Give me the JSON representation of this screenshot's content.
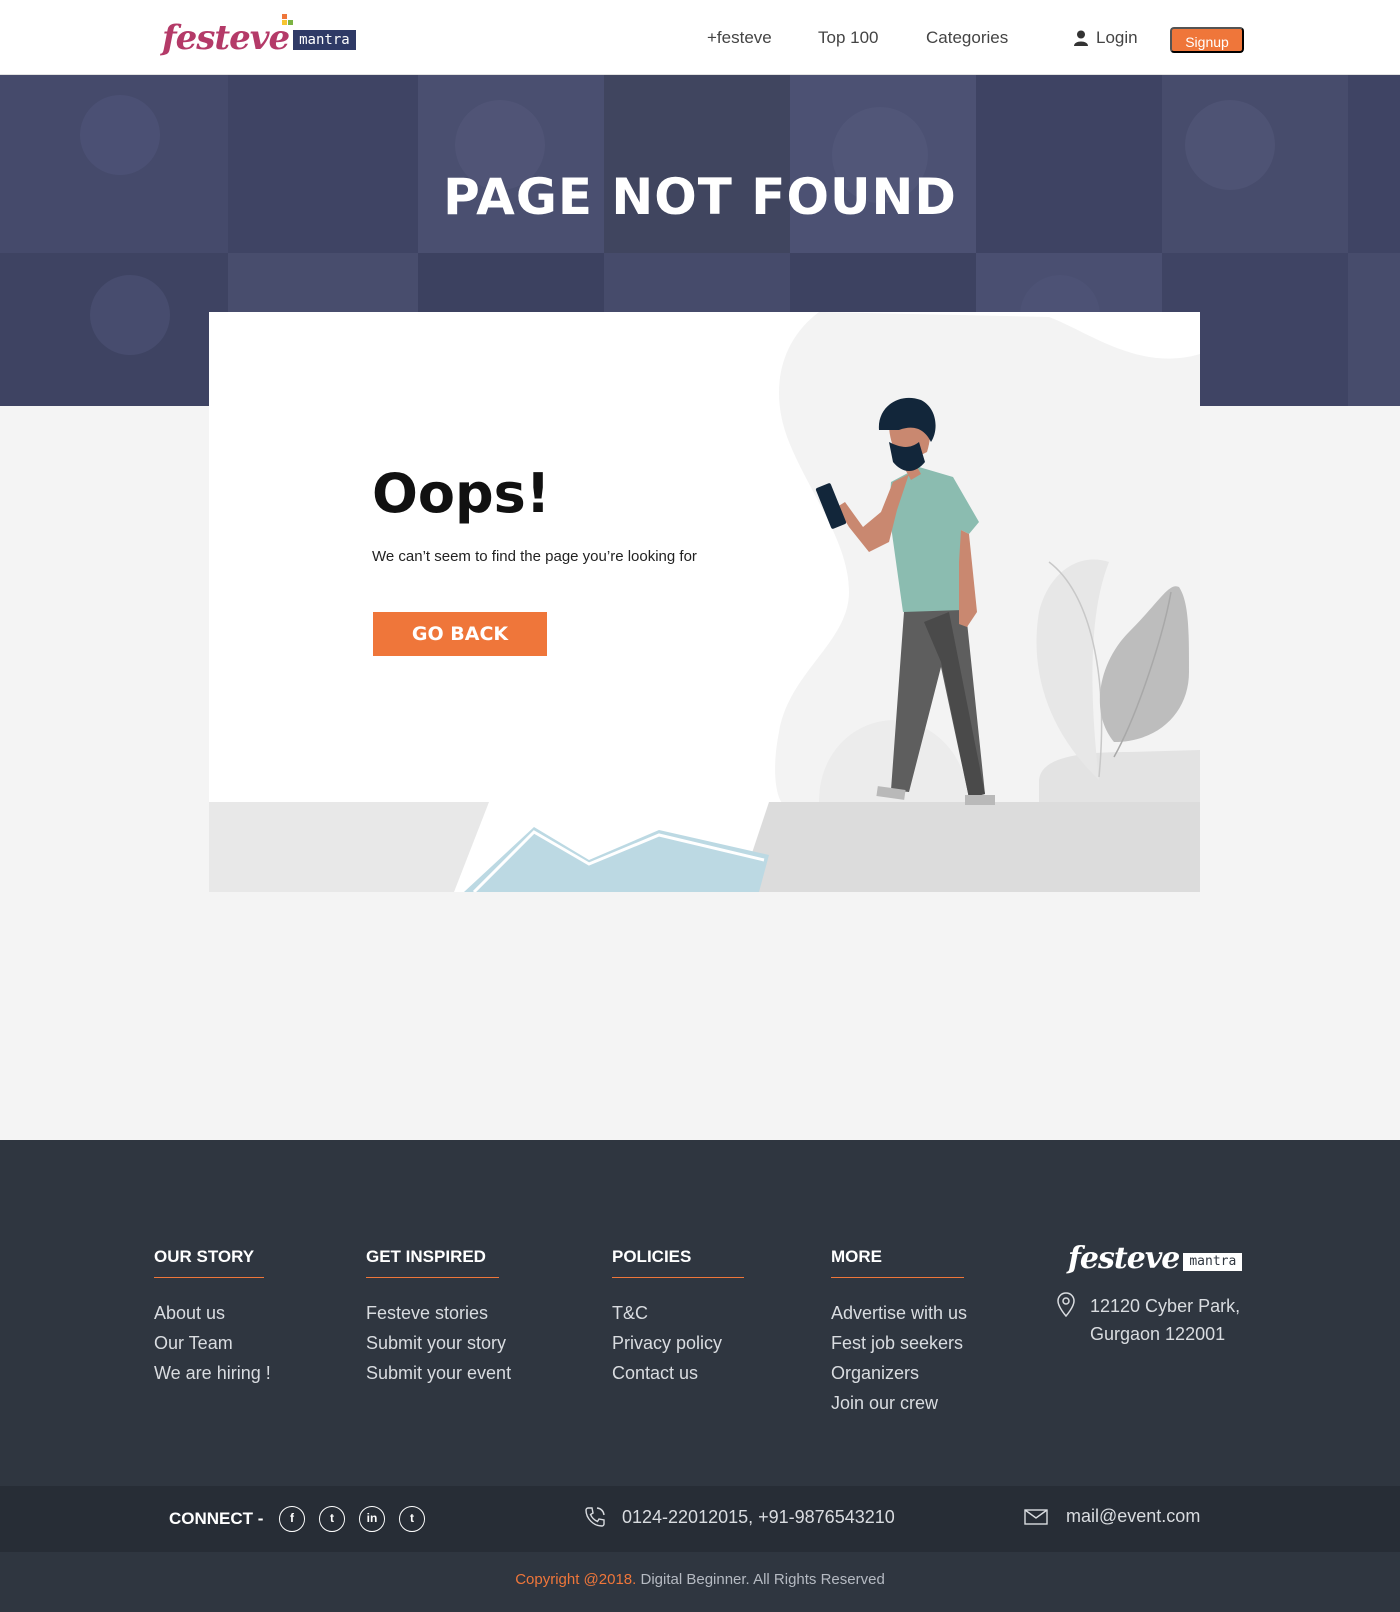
{
  "header": {
    "logo_word": "festeve",
    "logo_tag": "mantra",
    "nav": [
      {
        "label": "+festeve"
      },
      {
        "label": "Top 100"
      },
      {
        "label": "Categories"
      }
    ],
    "login_label": "Login",
    "signup_label": "Signup"
  },
  "hero": {
    "title": "PAGE NOT FOUND"
  },
  "error": {
    "heading": "Oops!",
    "message": "We can’t seem to find the page you’re looking for",
    "button_label": "GO BACK"
  },
  "footer": {
    "columns": [
      {
        "heading": "OUR STORY",
        "items": [
          "About us",
          "Our Team",
          "We are hiring !"
        ]
      },
      {
        "heading": "GET INSPIRED",
        "items": [
          "Festeve stories",
          "Submit your story",
          "Submit your event"
        ]
      },
      {
        "heading": "POLICIES",
        "items": [
          "T&C",
          "Privacy policy",
          "Contact us"
        ]
      },
      {
        "heading": "MORE",
        "items": [
          "Advertise with us",
          "Fest job seekers",
          "Organizers",
          "Join our crew"
        ]
      }
    ],
    "logo_word": "festeve",
    "logo_tag": "mantra",
    "address_line1": "12120 Cyber Park,",
    "address_line2": "Gurgaon 122001",
    "connect_label": "CONNECT -",
    "social": [
      {
        "icon": "facebook-icon",
        "glyph": "f"
      },
      {
        "icon": "twitter-icon",
        "glyph": "t"
      },
      {
        "icon": "linkedin-icon",
        "glyph": "in"
      },
      {
        "icon": "twitter-icon",
        "glyph": "t"
      }
    ],
    "phone": "0124-22012015, +91-9876543210",
    "email": "mail@event.com",
    "copyright_highlight": "Copyright @2018.",
    "copyright_rest": " Digital Beginner. All Rights Reserved"
  },
  "colors": {
    "accent": "#ef763a",
    "footer_bg": "#2f3640",
    "hero_overlay": "#3b4060"
  }
}
